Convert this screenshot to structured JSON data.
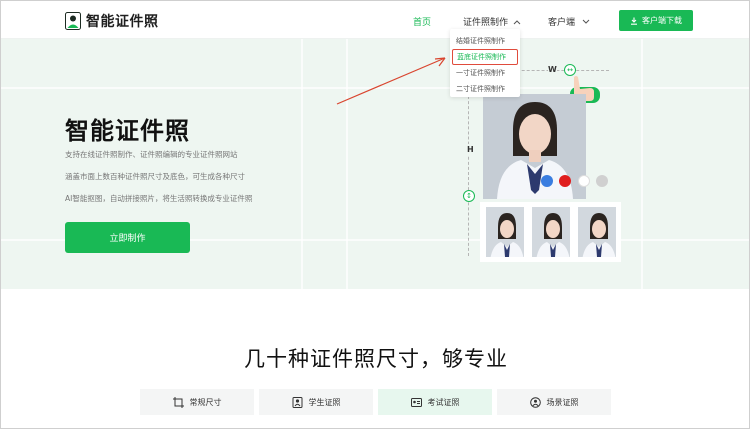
{
  "header": {
    "logo_text": "智能证件照",
    "nav": {
      "home": "首页",
      "id_photo": "证件照制作",
      "client": "客户端"
    },
    "download_button": "客户端下载"
  },
  "dropdown": {
    "items": [
      {
        "label": "结婚证件照制作"
      },
      {
        "label": "蓝底证件照制作"
      },
      {
        "label": "一寸证件照制作"
      },
      {
        "label": "二寸证件照制作"
      }
    ]
  },
  "hero": {
    "title": "智能证件照",
    "lines": [
      "支持在线证件照制作、证件照编辑的专业证件照网站",
      "涵盖市面上数百种证件照尺寸及底色，可生成各种尺寸",
      "AI智能抠图，自动拼接照片，将生活照转换成专业证件照"
    ],
    "cta": "立即制作",
    "dim_w": "W",
    "dim_h": "H",
    "swatches": [
      "#3a7de0",
      "#e01e1e",
      "#ffffff",
      "#d0d0d0"
    ]
  },
  "section": {
    "title": "几十种证件照尺寸，够专业",
    "tabs": [
      {
        "label": "常规尺寸",
        "icon": "crop-icon"
      },
      {
        "label": "学生证照",
        "icon": "id-badge-icon"
      },
      {
        "label": "考试证照",
        "icon": "id-card-icon"
      },
      {
        "label": "场景证照",
        "icon": "scene-icon"
      }
    ]
  },
  "colors": {
    "accent": "#19b955",
    "hero_bg": "#eef6f1",
    "arrow": "#d9452f"
  }
}
